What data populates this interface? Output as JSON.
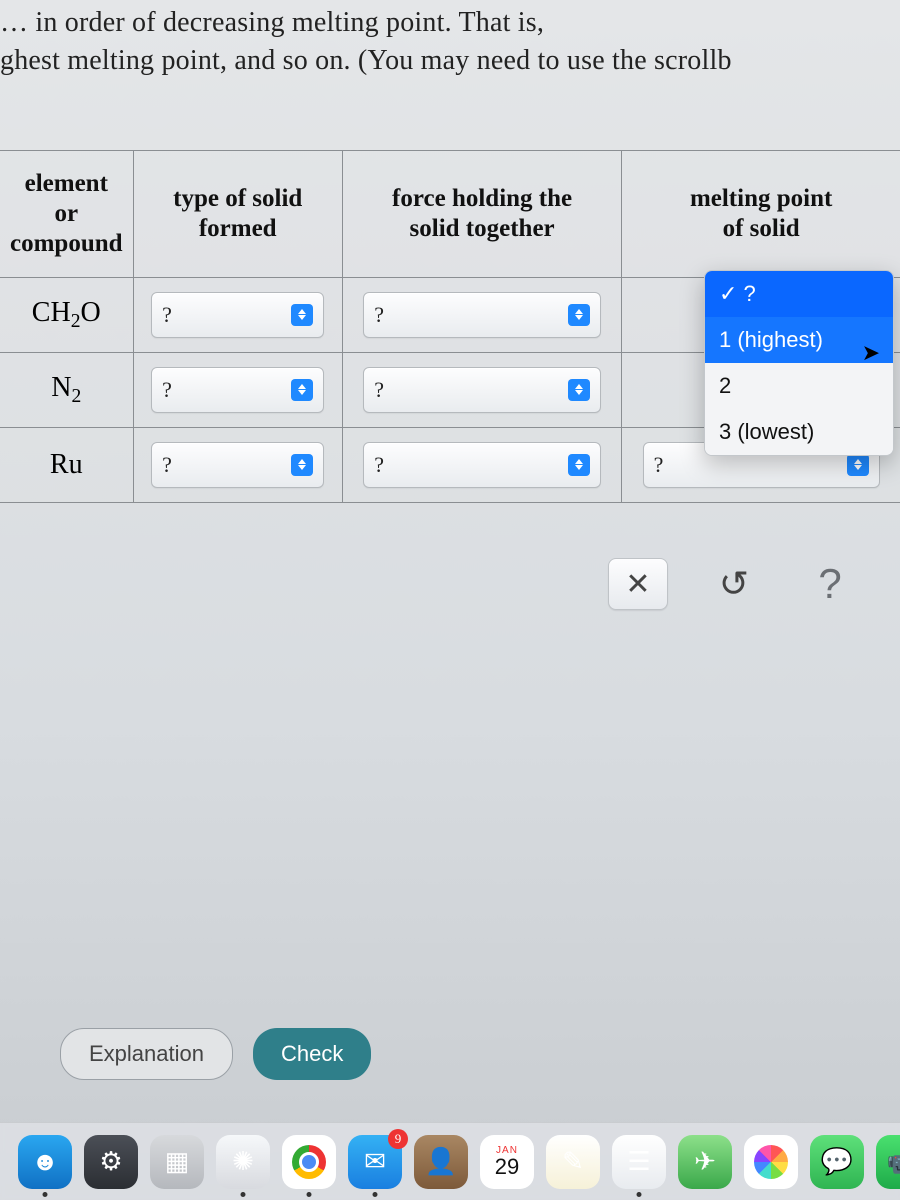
{
  "instruction_line1": "… in order of decreasing melting point. That is,",
  "instruction_line2": "ghest melting point, and so on. (You may need to use the scrollb",
  "headers": {
    "col0a": "element",
    "col0b": "or",
    "col0c": "compound",
    "col1a": "type of solid",
    "col1b": "formed",
    "col2a": "force holding the",
    "col2b": "solid together",
    "col3a": "melting point",
    "col3b": "of solid"
  },
  "rows": [
    {
      "label_html": "CH₂O",
      "type": "?",
      "force": "?",
      "mp": "?"
    },
    {
      "label_html": "N₂",
      "type": "?",
      "force": "?",
      "mp": "?"
    },
    {
      "label_html": "Ru",
      "type": "?",
      "force": "?",
      "mp": "?"
    }
  ],
  "dropdown": {
    "options": [
      "✓ ?",
      "1 (highest)",
      "2",
      "3 (lowest)"
    ],
    "current": "?",
    "highlighted": "1 (highest)"
  },
  "action_icons": {
    "clear": "✕",
    "undo": "↺",
    "help": "?"
  },
  "buttons": {
    "explanation": "Explanation",
    "check": "Check"
  },
  "calendar": {
    "month": "JAN",
    "day": "29"
  },
  "mail_badge": "9"
}
